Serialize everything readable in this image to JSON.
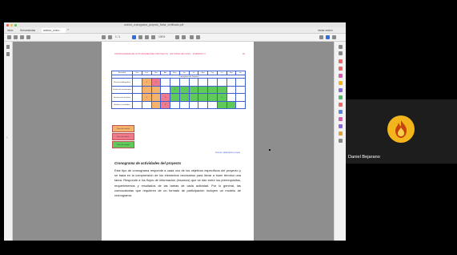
{
  "window": {
    "title": "archivo_cronograma_proyecto_Nafar_certificado.pdf"
  },
  "tabs": [
    {
      "label": "Inicio"
    },
    {
      "label": "Herramientas"
    },
    {
      "label": "archivo_crono..."
    }
  ],
  "toolbar": {
    "page_indicator": "1 / 1",
    "zoom": "100%",
    "sign_in": "Iniciar sesión"
  },
  "document": {
    "header_left": "CRONOGRAMA DE ACTIVIDADES DEL PROYECTO · ESTUDIO DE CASO · FORMATO 2",
    "page_number": "02",
    "gantt": {
      "columns": [
        "Actividad",
        "Ene",
        "Feb",
        "Mar",
        "Abr",
        "May",
        "Jun",
        "Jul",
        "Ago",
        "Sep",
        "Oct",
        "Nov",
        "Dic"
      ],
      "subheader": "Cronograma del Proyecto",
      "rows": [
        {
          "label": "Revisión bibliográfica",
          "cells": [
            "",
            "4",
            "3",
            "",
            "",
            "",
            "",
            "",
            "",
            "",
            "",
            ""
          ]
        },
        {
          "label": "Diseño de instrumentos",
          "cells": [
            "",
            "",
            "",
            "",
            "2",
            "",
            "",
            "",
            "",
            "",
            "",
            ""
          ]
        },
        {
          "label": "Recolección de datos",
          "cells": [
            "",
            "2",
            "",
            "3",
            "",
            "",
            "",
            "",
            "",
            "5",
            "",
            ""
          ]
        },
        {
          "label": "Análisis y resultados",
          "cells": [
            "",
            "",
            "",
            "4",
            "",
            "",
            "",
            "",
            "",
            "",
            "",
            ""
          ]
        }
      ]
    },
    "legend": [
      {
        "label": "Fase de revisión",
        "color": "#f4b26a"
      },
      {
        "label": "Fase de análisis",
        "color": "#f07a8c"
      },
      {
        "label": "Fase de campo",
        "color": "#5fc95a"
      }
    ],
    "footnote": "Fuente: elaboración propia",
    "section_title": "Cronograma de actividades del proyecto",
    "paragraph": "Este tipo de cronograma responde a cada uno de los objetivos específicos del proyecto y se basa en la comprensión de los elementos necesarios para llevar a buen término una tarea. Responde a los flujos de información (insumos) que se dan entre los prerrequisitos, requerimientos y resultados de las tareas de cada actividad. Por lo general, las convocatorias que requieren de un formato de participación incluyen un modelo de cronograma."
  },
  "participant": {
    "name": "Daniel Bejarano",
    "avatar_color": "#f2b51c"
  },
  "colors": {
    "orange": "#f4b26a",
    "pink": "#f07a8c",
    "green": "#5fc95a",
    "table_border": "#3f5fd0"
  }
}
